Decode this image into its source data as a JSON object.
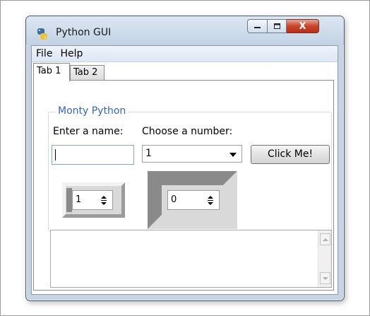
{
  "window": {
    "title": "Python GUI",
    "close_glyph": "X",
    "accent_color": "#c5d3e3"
  },
  "menubar": {
    "items": [
      "File",
      "Help"
    ]
  },
  "tabs": [
    {
      "label": "Tab 1",
      "active": true
    },
    {
      "label": "Tab 2",
      "active": false
    }
  ],
  "group": {
    "title": "Monty Python",
    "name_label": "Enter a name:",
    "number_label": "Choose a number:",
    "name_value": "",
    "number_value": "1",
    "button_label": "Click Me!",
    "spinbox_1_value": "1",
    "spinbox_2_value": "0"
  },
  "scrolled_text": {
    "value": ""
  }
}
